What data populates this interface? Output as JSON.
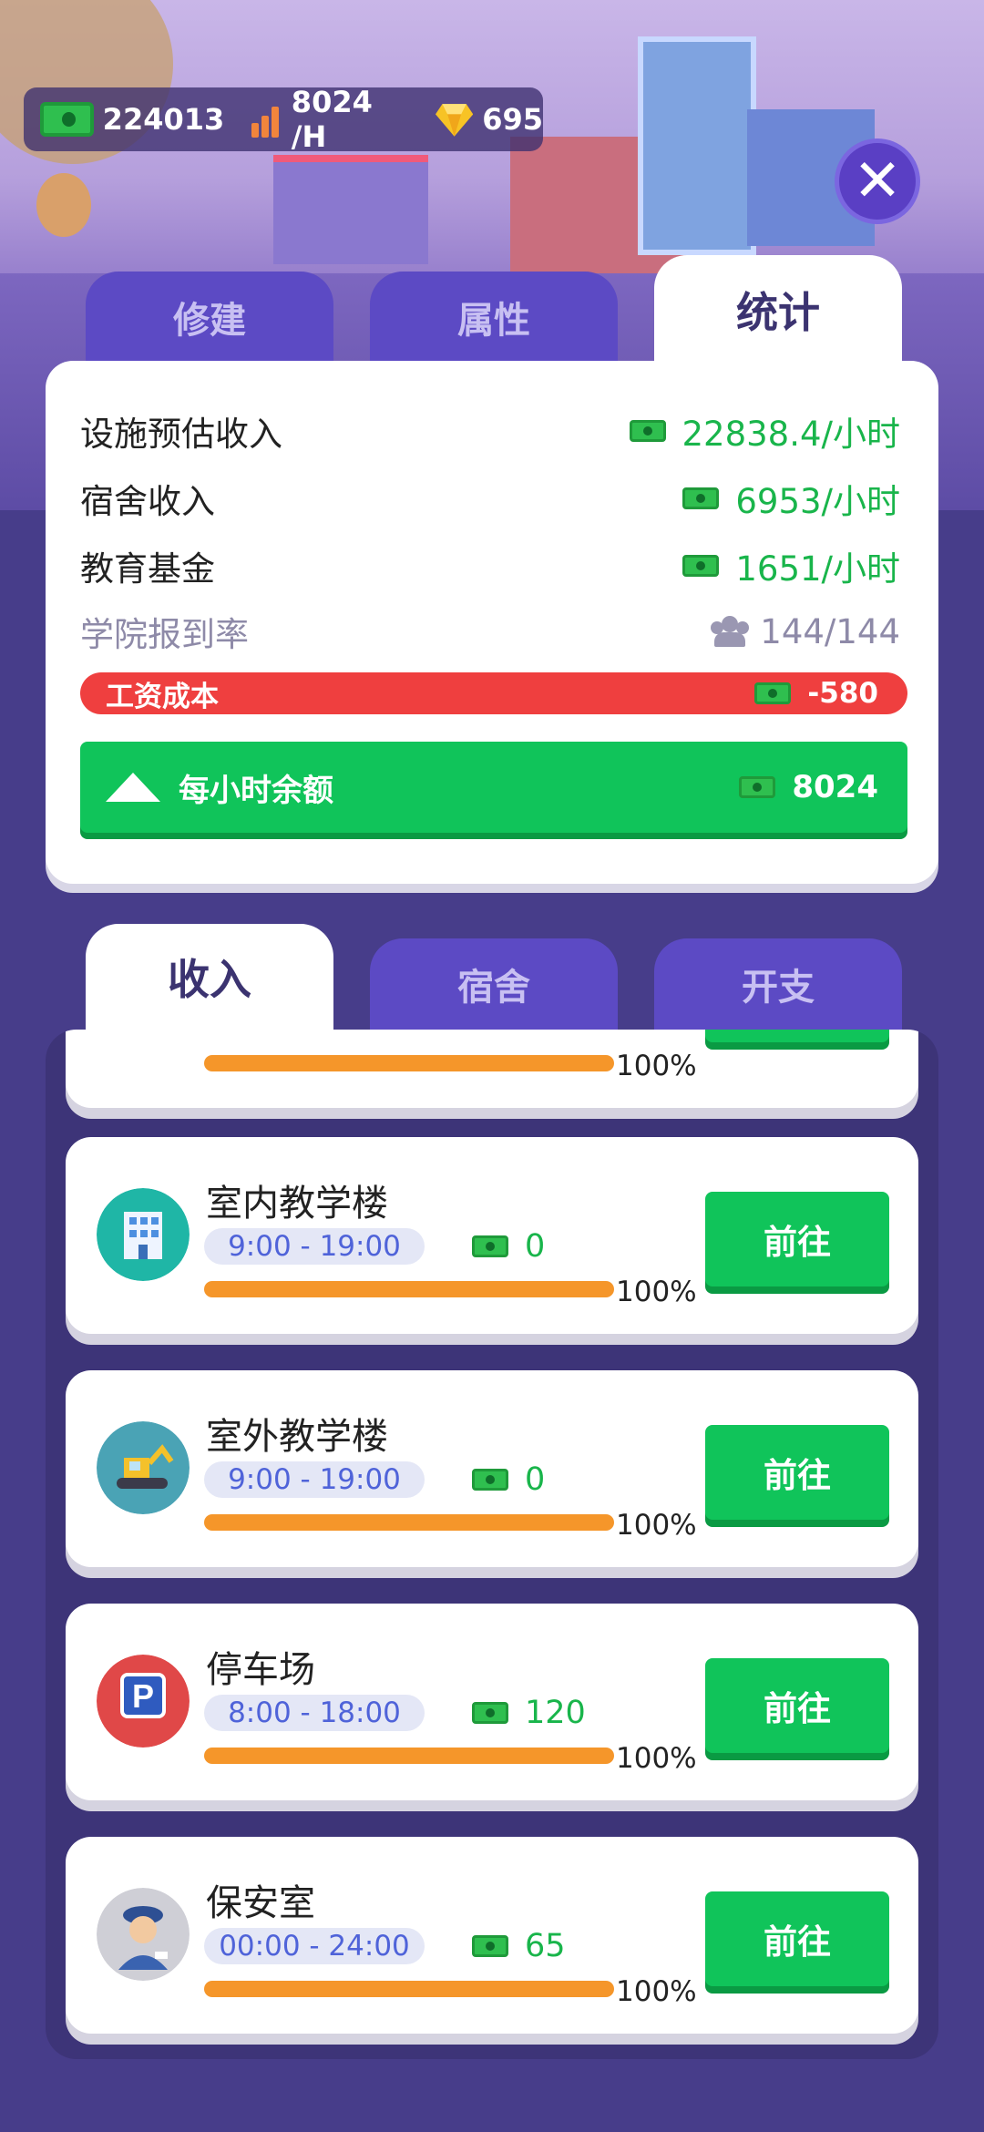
{
  "currency": {
    "cash": "224013",
    "rate": "8024 /H",
    "gems": "695"
  },
  "tabs_top": [
    {
      "label": "修建",
      "active": false
    },
    {
      "label": "属性",
      "active": false
    },
    {
      "label": "统计",
      "active": true
    }
  ],
  "stats": {
    "facility_income": {
      "label": "设施预估收入",
      "value": "22838.4/小时"
    },
    "dorm_income": {
      "label": "宿舍收入",
      "value": "6953/小时"
    },
    "edu_fund": {
      "label": "教育基金",
      "value": "1651/小时"
    },
    "enroll_rate": {
      "label": "学院报到率",
      "value": "144/144"
    },
    "wage_cost": {
      "label": "工资成本",
      "value": "-580"
    },
    "hourly_balance": {
      "label": "每小时余额",
      "value": "8024"
    }
  },
  "tabs_bottom": [
    {
      "label": "收入",
      "active": true
    },
    {
      "label": "宿舍",
      "active": false
    },
    {
      "label": "开支",
      "active": false
    }
  ],
  "partial_card": {
    "percent": "100%"
  },
  "facilities": [
    {
      "name": "室内教学楼",
      "hours": "9:00 - 19:00",
      "income": "0",
      "progress": 1.0,
      "percent": "100%",
      "button": "前往",
      "icon": "building-icon"
    },
    {
      "name": "室外教学楼",
      "hours": "9:00 - 19:00",
      "income": "0",
      "progress": 1.0,
      "percent": "100%",
      "button": "前往",
      "icon": "excavator-icon"
    },
    {
      "name": "停车场",
      "hours": "8:00 - 18:00",
      "income": "120",
      "progress": 1.0,
      "percent": "100%",
      "button": "前往",
      "icon": "parking-icon"
    },
    {
      "name": "保安室",
      "hours": "00:00 - 24:00",
      "income": "65",
      "progress": 1.0,
      "percent": "100%",
      "button": "前往",
      "icon": "security-guard-icon"
    }
  ],
  "colors": {
    "accent_green": "#10c45a",
    "cost_red": "#ef3f3f",
    "progress_orange": "#f5962a",
    "tab_purple": "#5c4ac4"
  }
}
